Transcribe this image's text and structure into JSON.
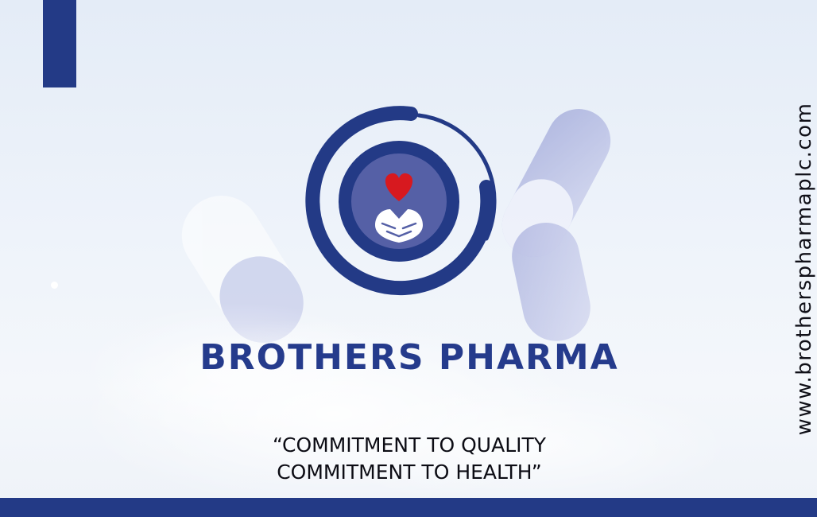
{
  "brand": {
    "name": "BROTHERS PHARMA",
    "tagline_line1": "“COMMITMENT TO QUALITY",
    "tagline_line2": "COMMITMENT TO HEALTH”",
    "website": "www.brotherspharmaplc.com"
  },
  "logo": {
    "icon": "heart-and-hands-icon"
  },
  "colors": {
    "brand_blue": "#233a86",
    "heart_red": "#d7191f",
    "inner_circle": "#5560a6",
    "text_dark": "#0c0c14"
  }
}
